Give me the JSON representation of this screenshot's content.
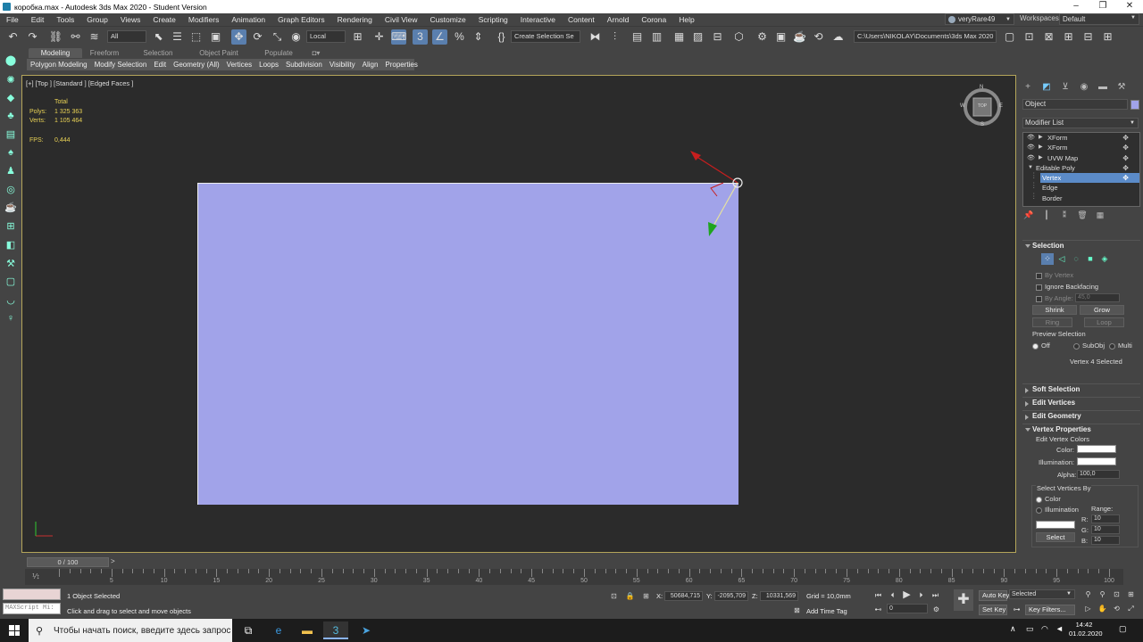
{
  "window": {
    "title": "коробка.max - Autodesk 3ds Max 2020 - Student Version"
  },
  "menu": [
    "File",
    "Edit",
    "Tools",
    "Group",
    "Views",
    "Create",
    "Modifiers",
    "Animation",
    "Graph Editors",
    "Rendering",
    "Civil View",
    "Customize",
    "Scripting",
    "Interactive",
    "Content",
    "Arnold",
    "Corona",
    "Help"
  ],
  "user": {
    "name": "veryRare49",
    "workspaces_label": "Workspaces:",
    "workspace": "Default"
  },
  "toolbar": {
    "filter": "All",
    "coord_system": "Local",
    "named_selection": "Create Selection Se",
    "project_path": "C:\\Users\\NIKOLAY\\Documents\\3ds Max 2020"
  },
  "ribbon": {
    "tabs": [
      "Modeling",
      "Freeform",
      "Selection",
      "Object Paint",
      "Populate"
    ],
    "subtabs": [
      "Polygon Modeling",
      "Modify Selection",
      "Edit",
      "Geometry (All)",
      "Vertices",
      "Loops",
      "Subdivision",
      "Visibility",
      "Align",
      "Properties"
    ]
  },
  "viewport": {
    "label": "[+] [Top ] [Standard ] [Edged Faces ]",
    "stats_header": "Total",
    "polys_label": "Polys:",
    "polys": "1 325 363",
    "verts_label": "Verts:",
    "verts": "1 105 464",
    "fps_label": "FPS:",
    "fps": "0,444",
    "viewcube_label": "TOP",
    "compass": {
      "n": "N",
      "s": "S",
      "e": "E",
      "w": "W"
    },
    "object_color": "#a1a3e9"
  },
  "command_panel": {
    "object_name": "Object",
    "modifier_list": "Modifier List",
    "stack": [
      {
        "label": "XForm",
        "selected": false,
        "indent": false
      },
      {
        "label": "XForm",
        "selected": false,
        "indent": false
      },
      {
        "label": "UVW Map",
        "selected": false,
        "indent": false
      },
      {
        "label": "Editable Poly",
        "selected": false,
        "indent": false
      },
      {
        "label": "Vertex",
        "selected": true,
        "indent": true
      },
      {
        "label": "Edge",
        "selected": false,
        "indent": true
      },
      {
        "label": "Border",
        "selected": false,
        "indent": true
      }
    ],
    "selection": {
      "title": "Selection",
      "by_vertex": "By Vertex",
      "ignore_backfacing": "Ignore Backfacing",
      "by_angle": "By Angle:",
      "by_angle_value": "45,0",
      "shrink": "Shrink",
      "grow": "Grow",
      "ring": "Ring",
      "loop": "Loop",
      "preview_selection": "Preview Selection",
      "preview_off": "Off",
      "preview_subobj": "SubObj",
      "preview_multi": "Multi",
      "status": "Vertex 4 Selected"
    },
    "rollouts": {
      "soft_selection": "Soft Selection",
      "edit_vertices": "Edit Vertices",
      "edit_geometry": "Edit Geometry",
      "vertex_properties": "Vertex Properties"
    },
    "vertex_properties": {
      "edit_vertex_colors": "Edit Vertex Colors",
      "color_label": "Color:",
      "illumination_label": "Illumination:",
      "alpha_label": "Alpha:",
      "alpha_value": "100,0",
      "select_vertices_by": "Select Vertices By",
      "by_color": "Color",
      "by_illumination": "Illumination",
      "range_label": "Range:",
      "r_label": "R:",
      "r_value": "10",
      "g_label": "G:",
      "g_value": "10",
      "b_label": "B:",
      "b_value": "10",
      "select_button": "Select"
    }
  },
  "timeline": {
    "slider": "0 / 100",
    "ticks": [
      "0",
      "5",
      "10",
      "15",
      "20",
      "25",
      "30",
      "35",
      "40",
      "45",
      "50",
      "55",
      "60",
      "65",
      "70",
      "75",
      "80",
      "85",
      "90",
      "95",
      "100"
    ]
  },
  "status": {
    "maxscript_placeholder": "MAXScript Mi:",
    "selection": "1 Object Selected",
    "prompt": "Click and drag to select and move objects",
    "x_label": "X:",
    "x": "50684,715",
    "y_label": "Y:",
    "y": "-2095,709",
    "z_label": "Z:",
    "z": "10331,569",
    "grid": "Grid = 10,0mm",
    "add_time_tag": "Add Time Tag",
    "frame": "0",
    "auto_key": "Auto Key",
    "set_key": "Set Key",
    "selected": "Selected",
    "key_filters": "Key Filters..."
  },
  "taskbar": {
    "search_placeholder": "Чтобы начать поиск, введите здесь запрос",
    "time": "14:42",
    "date": "01.02.2020"
  }
}
